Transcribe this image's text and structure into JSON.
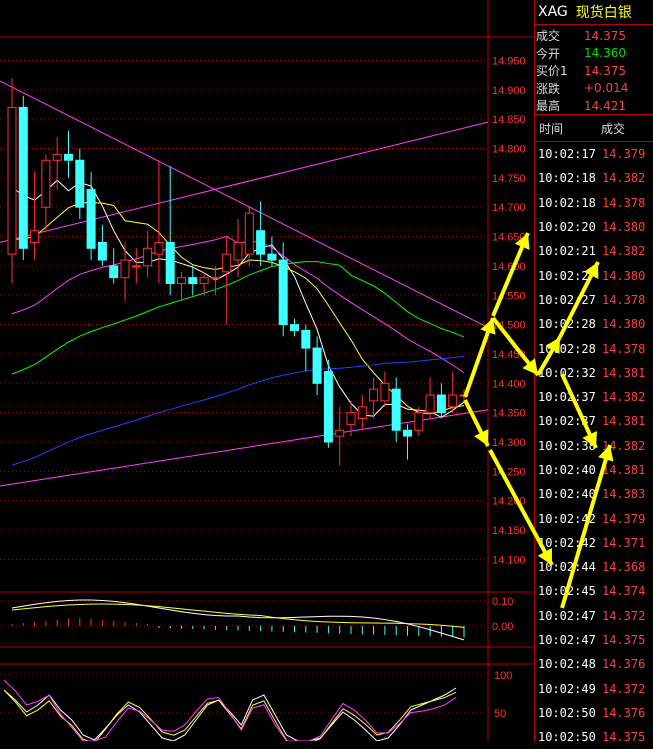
{
  "header": {
    "symbol": "XAG",
    "name": "现货白银"
  },
  "quote": [
    {
      "label": "成交",
      "value": "14.375",
      "color": "red"
    },
    {
      "label": "今开",
      "value": "14.360",
      "color": "green"
    },
    {
      "label": "买价1",
      "value": "14.375",
      "color": "red"
    },
    {
      "label": "涨跌",
      "value": "+0.014",
      "color": "red"
    },
    {
      "label": "最高",
      "value": "14.421",
      "color": "red"
    }
  ],
  "ticks": {
    "col_time": "时间",
    "col_price": "成交",
    "rows": [
      {
        "time": "10:02:17",
        "price": "14.379"
      },
      {
        "time": "10:02:18",
        "price": "14.382"
      },
      {
        "time": "10:02:18",
        "price": "14.378"
      },
      {
        "time": "10:02:20",
        "price": "14.380"
      },
      {
        "time": "10:02:21",
        "price": "14.382"
      },
      {
        "time": "10:02:2",
        "price": "14.380"
      },
      {
        "time": "10:02:27",
        "price": "14.378"
      },
      {
        "time": "10:02:28",
        "price": "14.380"
      },
      {
        "time": "10:02:28",
        "price": "14.378"
      },
      {
        "time": "10:02:32",
        "price": "14.381"
      },
      {
        "time": "10:02:37",
        "price": "14.382"
      },
      {
        "time": "10:02:37",
        "price": "14.381"
      },
      {
        "time": "10:02:38",
        "price": "14.382"
      },
      {
        "time": "10:02:40",
        "price": "14.381"
      },
      {
        "time": "10:02:40",
        "price": "14.383"
      },
      {
        "time": "10:02:42",
        "price": "14.379"
      },
      {
        "time": "10:02:42",
        "price": "14.371"
      },
      {
        "time": "10:02:44",
        "price": "14.368"
      },
      {
        "time": "10:02:45",
        "price": "14.374"
      },
      {
        "time": "10:02:47",
        "price": "14.372"
      },
      {
        "time": "10:02:47",
        "price": "14.375"
      },
      {
        "time": "10:02:48",
        "price": "14.376"
      },
      {
        "time": "10:02:49",
        "price": "14.372"
      },
      {
        "time": "10:02:50",
        "price": "14.376"
      },
      {
        "time": "10:02:50",
        "price": "14.375"
      }
    ]
  },
  "colors": {
    "up": "#ff3030",
    "down": "#40ffff",
    "grid": "#b00000",
    "axis_text": "#ff3030",
    "arrow": "#ffff00"
  },
  "chart_data": {
    "type": "candlestick",
    "y_ticks": [
      "14.950",
      "14.900",
      "14.850",
      "14.800",
      "14.750",
      "14.700",
      "14.650",
      "14.600",
      "14.550",
      "14.500",
      "14.450",
      "14.400",
      "14.350",
      "14.300",
      "14.250",
      "14.200",
      "14.150",
      "14.100"
    ],
    "ylim": [
      14.07,
      14.99
    ],
    "candles": [
      {
        "o": 14.62,
        "h": 14.92,
        "l": 14.57,
        "c": 14.87
      },
      {
        "o": 14.87,
        "h": 14.89,
        "l": 14.61,
        "c": 14.63
      },
      {
        "o": 14.64,
        "h": 14.76,
        "l": 14.61,
        "c": 14.66
      },
      {
        "o": 14.7,
        "h": 14.79,
        "l": 14.66,
        "c": 14.78
      },
      {
        "o": 14.78,
        "h": 14.82,
        "l": 14.73,
        "c": 14.79
      },
      {
        "o": 14.79,
        "h": 14.83,
        "l": 14.75,
        "c": 14.78
      },
      {
        "o": 14.78,
        "h": 14.8,
        "l": 14.68,
        "c": 14.7
      },
      {
        "o": 14.73,
        "h": 14.76,
        "l": 14.61,
        "c": 14.63
      },
      {
        "o": 14.64,
        "h": 14.67,
        "l": 14.6,
        "c": 14.61
      },
      {
        "o": 14.6,
        "h": 14.63,
        "l": 14.57,
        "c": 14.58
      },
      {
        "o": 14.58,
        "h": 14.64,
        "l": 14.54,
        "c": 14.61
      },
      {
        "o": 14.6,
        "h": 14.63,
        "l": 14.57,
        "c": 14.6
      },
      {
        "o": 14.6,
        "h": 14.66,
        "l": 14.58,
        "c": 14.63
      },
      {
        "o": 14.62,
        "h": 14.78,
        "l": 14.57,
        "c": 14.64
      },
      {
        "o": 14.64,
        "h": 14.77,
        "l": 14.55,
        "c": 14.57
      },
      {
        "o": 14.57,
        "h": 14.59,
        "l": 14.54,
        "c": 14.58
      },
      {
        "o": 14.58,
        "h": 14.6,
        "l": 14.55,
        "c": 14.57
      },
      {
        "o": 14.57,
        "h": 14.59,
        "l": 14.55,
        "c": 14.58
      },
      {
        "o": 14.58,
        "h": 14.6,
        "l": 14.55,
        "c": 14.58
      },
      {
        "o": 14.59,
        "h": 14.65,
        "l": 14.5,
        "c": 14.62
      },
      {
        "o": 14.61,
        "h": 14.68,
        "l": 14.58,
        "c": 14.64
      },
      {
        "o": 14.62,
        "h": 14.7,
        "l": 14.6,
        "c": 14.69
      },
      {
        "o": 14.66,
        "h": 14.71,
        "l": 14.6,
        "c": 14.62
      },
      {
        "o": 14.62,
        "h": 14.65,
        "l": 14.6,
        "c": 14.61
      },
      {
        "o": 14.61,
        "h": 14.64,
        "l": 14.48,
        "c": 14.5
      },
      {
        "o": 14.5,
        "h": 14.51,
        "l": 14.48,
        "c": 14.49
      },
      {
        "o": 14.49,
        "h": 14.5,
        "l": 14.42,
        "c": 14.46
      },
      {
        "o": 14.46,
        "h": 14.48,
        "l": 14.38,
        "c": 14.4
      },
      {
        "o": 14.42,
        "h": 14.44,
        "l": 14.29,
        "c": 14.3
      },
      {
        "o": 14.31,
        "h": 14.36,
        "l": 14.26,
        "c": 14.32
      },
      {
        "o": 14.33,
        "h": 14.37,
        "l": 14.31,
        "c": 14.35
      },
      {
        "o": 14.34,
        "h": 14.38,
        "l": 14.32,
        "c": 14.36
      },
      {
        "o": 14.37,
        "h": 14.41,
        "l": 14.34,
        "c": 14.39
      },
      {
        "o": 14.37,
        "h": 14.42,
        "l": 14.36,
        "c": 14.4
      },
      {
        "o": 14.39,
        "h": 14.41,
        "l": 14.3,
        "c": 14.32
      },
      {
        "o": 14.32,
        "h": 14.33,
        "l": 14.27,
        "c": 14.31
      },
      {
        "o": 14.32,
        "h": 14.36,
        "l": 14.31,
        "c": 14.35
      },
      {
        "o": 14.35,
        "h": 14.41,
        "l": 14.34,
        "c": 14.38
      },
      {
        "o": 14.38,
        "h": 14.4,
        "l": 14.34,
        "c": 14.35
      },
      {
        "o": 14.36,
        "h": 14.42,
        "l": 14.35,
        "c": 14.38
      },
      {
        "o": 14.38,
        "h": 14.39,
        "l": 14.37,
        "c": 14.38
      }
    ],
    "macd_ticks": [
      "0.10",
      "0.00"
    ],
    "kdj_ticks": [
      "100",
      "50"
    ]
  }
}
